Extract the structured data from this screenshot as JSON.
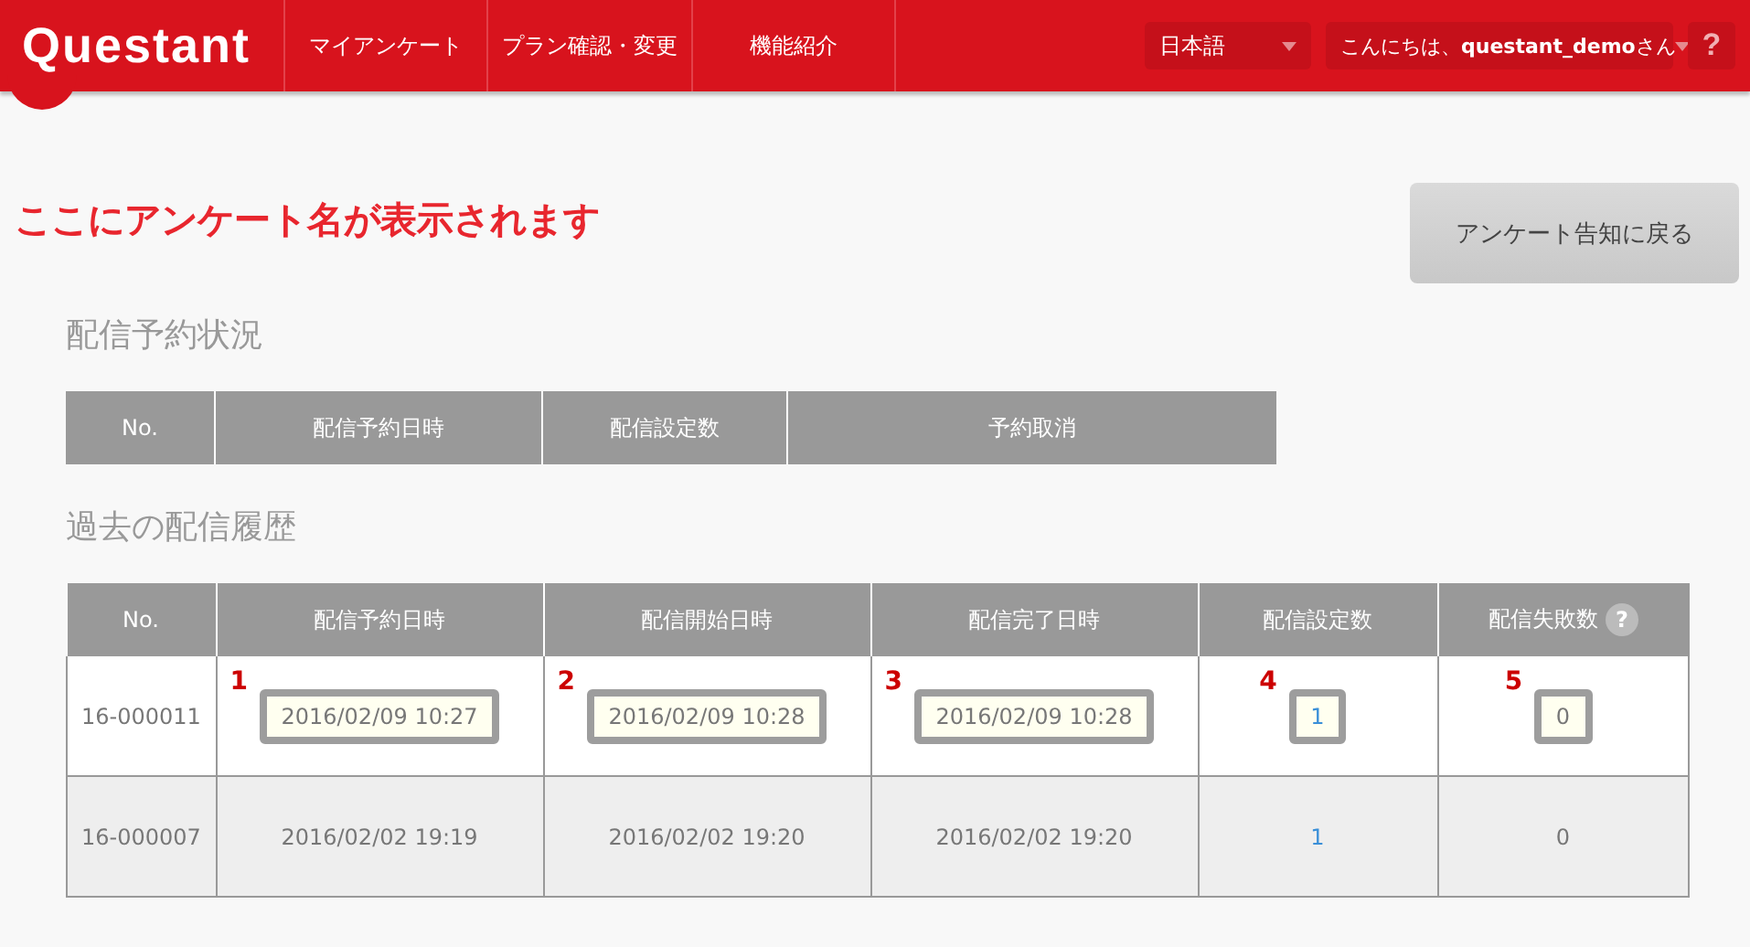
{
  "header": {
    "logo": "Questant",
    "nav": [
      "マイアンケート",
      "プラン確認・変更",
      "機能紹介"
    ],
    "language": "日本語",
    "greeting": "こんにちは、**questant_demo**さん",
    "help": "?"
  },
  "survey_title": "ここにアンケート名が表示されます",
  "back_button": "アンケート告知に戻る",
  "reservations": {
    "title": "配信予約状況",
    "columns": [
      {
        "label": "No."
      },
      {
        "label": "配信予約日時"
      },
      {
        "label": "配信設定数"
      },
      {
        "label": "予約取消"
      }
    ]
  },
  "history": {
    "title": "過去の配信履歴",
    "columns": [
      {
        "label": "No."
      },
      {
        "label": "配信予約日時"
      },
      {
        "label": "配信開始日時"
      },
      {
        "label": "配信完了日時"
      },
      {
        "label": "配信設定数"
      },
      {
        "label": "配信失敗数",
        "help": "?"
      }
    ],
    "rows": [
      {
        "cells": [
          {
            "text": "16-000011",
            "kind": "plain"
          },
          {
            "text": "2016/02/09 10:27",
            "kind": "plain",
            "callout": "1"
          },
          {
            "text": "2016/02/09 10:28",
            "kind": "plain",
            "callout": "2"
          },
          {
            "text": "2016/02/09 10:28",
            "kind": "plain",
            "callout": "3"
          },
          {
            "text": "1",
            "kind": "link",
            "callout": "4"
          },
          {
            "text": "0",
            "kind": "plain",
            "callout": "5"
          }
        ]
      },
      {
        "cells": [
          {
            "text": "16-000007",
            "kind": "plain"
          },
          {
            "text": "2016/02/02 19:19",
            "kind": "plain"
          },
          {
            "text": "2016/02/02 19:20",
            "kind": "plain"
          },
          {
            "text": "2016/02/02 19:20",
            "kind": "plain"
          },
          {
            "text": "1",
            "kind": "link"
          },
          {
            "text": "0",
            "kind": "plain"
          }
        ]
      }
    ]
  }
}
